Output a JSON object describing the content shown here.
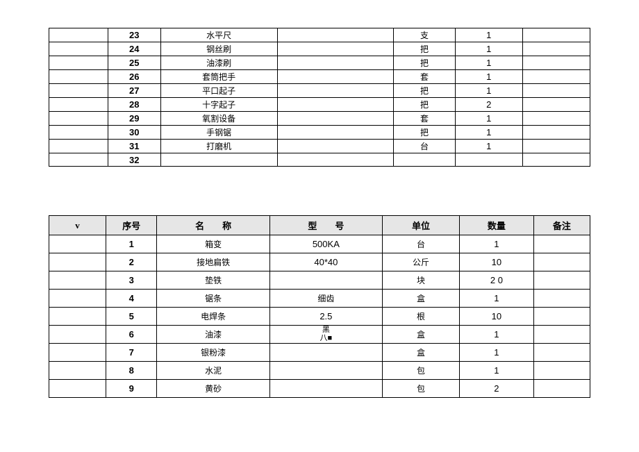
{
  "table1": {
    "rows": [
      {
        "seq": "23",
        "name": "水平尺",
        "model": "",
        "unit": "支",
        "qty": "1"
      },
      {
        "seq": "24",
        "name": "钢丝刷",
        "model": "",
        "unit": "把",
        "qty": "1"
      },
      {
        "seq": "25",
        "name": "油漆刷",
        "model": "",
        "unit": "把",
        "qty": "1"
      },
      {
        "seq": "26",
        "name": "套筒把手",
        "model": "",
        "unit": "套",
        "qty": "1"
      },
      {
        "seq": "27",
        "name": "平口起子",
        "model": "",
        "unit": "把",
        "qty": "1"
      },
      {
        "seq": "28",
        "name": "十字起子",
        "model": "",
        "unit": "把",
        "qty": "2"
      },
      {
        "seq": "29",
        "name": "氧割设备",
        "model": "",
        "unit": "套",
        "qty": "1"
      },
      {
        "seq": "30",
        "name": "手钢锯",
        "model": "",
        "unit": "把",
        "qty": "1"
      },
      {
        "seq": "31",
        "name": "打磨机",
        "model": "",
        "unit": "台",
        "qty": "1"
      },
      {
        "seq": "32",
        "name": "",
        "model": "",
        "unit": "",
        "qty": ""
      }
    ]
  },
  "table2": {
    "headers": {
      "c0": "v",
      "c1": "序号",
      "c2": "名　　称",
      "c3": "型　　号",
      "c4": "单位",
      "c5": "数量",
      "c6": "备注"
    },
    "rows": [
      {
        "seq": "1",
        "name": "箱变",
        "model": "500KA",
        "unit": "台",
        "qty": "1",
        "remark": ""
      },
      {
        "seq": "2",
        "name": "接地扁铁",
        "model": "40*40",
        "unit": "公斤",
        "qty": "10",
        "remark": ""
      },
      {
        "seq": "3",
        "name": "垫铁",
        "model": "",
        "unit": "块",
        "qty": "2 0",
        "remark": ""
      },
      {
        "seq": "4",
        "name": "锯条",
        "model": "细齿",
        "unit": "盒",
        "qty": "1",
        "remark": ""
      },
      {
        "seq": "5",
        "name": "电焊条",
        "model": "2.5",
        "unit": "根",
        "qty": "10",
        "remark": ""
      },
      {
        "seq": "6",
        "name": "油漆",
        "model_top": "黑",
        "model_bot": "八■",
        "unit": "盒",
        "qty": "1",
        "remark": ""
      },
      {
        "seq": "7",
        "name": "银粉漆",
        "model": "",
        "unit": "盒",
        "qty": "1",
        "remark": ""
      },
      {
        "seq": "8",
        "name": "水泥",
        "model": "",
        "unit": "包",
        "qty": "1",
        "remark": ""
      },
      {
        "seq": "9",
        "name": "黄砂",
        "model": "",
        "unit": "包",
        "qty": "2",
        "remark": ""
      }
    ]
  }
}
